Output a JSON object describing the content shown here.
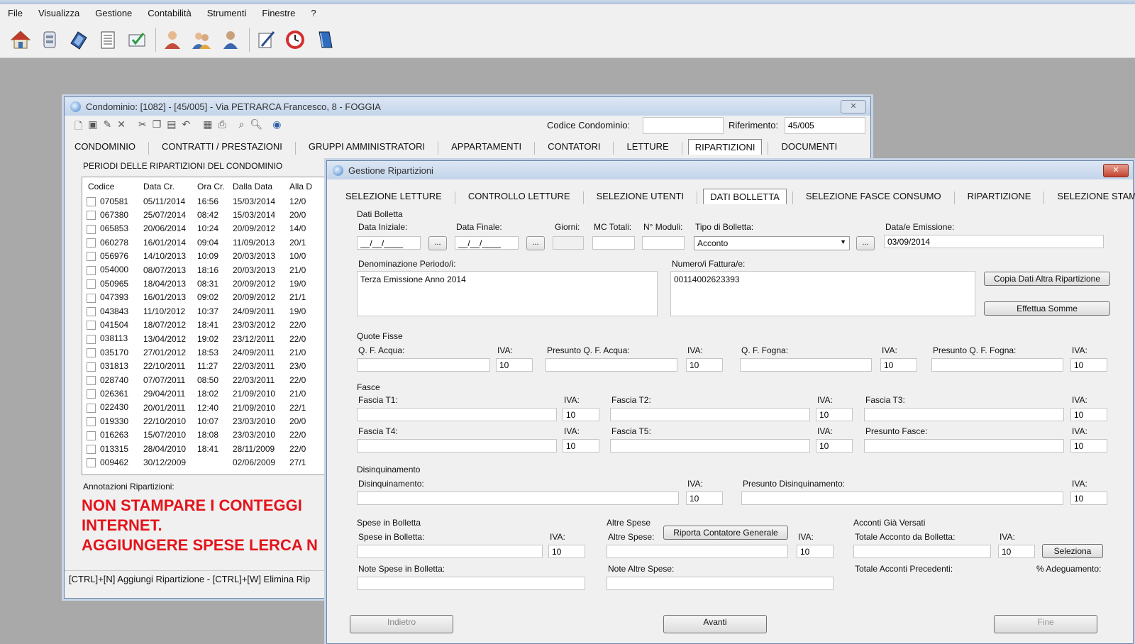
{
  "menu": [
    "File",
    "Visualizza",
    "Gestione",
    "Contabilità",
    "Strumenti",
    "Finestre",
    "?"
  ],
  "toolbar_icons": [
    "home-icon",
    "archive-icon",
    "books-icon",
    "ledger-icon",
    "check-list-icon",
    "user-icon",
    "users-icon",
    "person-icon",
    "edit-icon",
    "clock-icon",
    "book-icon"
  ],
  "cond": {
    "title": "Condominio: [1082] - [45/005] - Via PETRARCA Francesco, 8 - FOGGIA",
    "codice_label": "Codice Condominio:",
    "codice_value": "",
    "riferimento_label": "Riferimento:",
    "riferimento_value": "45/005",
    "tabs": [
      "CONDOMINIO",
      "CONTRATTI / PRESTAZIONI",
      "GRUPPI AMMINISTRATORI",
      "APPARTAMENTI",
      "CONTATORI",
      "LETTURE",
      "RIPARTIZIONI",
      "DOCUMENTI"
    ],
    "section_title": "PERIODI DELLE RIPARTIZIONI DEL CONDOMINIO",
    "columns": [
      "Codice",
      "Data Cr.",
      "Ora Cr.",
      "Dalla Data",
      "Alla D"
    ],
    "rows": [
      [
        "070581",
        "05/11/2014",
        "16:56",
        "15/03/2014",
        "12/0"
      ],
      [
        "067380",
        "25/07/2014",
        "08:42",
        "15/03/2014",
        "20/0"
      ],
      [
        "065853",
        "20/06/2014",
        "10:24",
        "20/09/2012",
        "14/0"
      ],
      [
        "060278",
        "16/01/2014",
        "09:04",
        "11/09/2013",
        "20/1"
      ],
      [
        "056976",
        "14/10/2013",
        "10:09",
        "20/03/2013",
        "10/0"
      ],
      [
        "054000",
        "08/07/2013",
        "18:16",
        "20/03/2013",
        "21/0"
      ],
      [
        "050965",
        "18/04/2013",
        "08:31",
        "20/09/2012",
        "19/0"
      ],
      [
        "047393",
        "16/01/2013",
        "09:02",
        "20/09/2012",
        "21/1"
      ],
      [
        "043843",
        "11/10/2012",
        "10:37",
        "24/09/2011",
        "19/0"
      ],
      [
        "041504",
        "18/07/2012",
        "18:41",
        "23/03/2012",
        "22/0"
      ],
      [
        "038113",
        "13/04/2012",
        "19:02",
        "23/12/2011",
        "22/0"
      ],
      [
        "035170",
        "27/01/2012",
        "18:53",
        "24/09/2011",
        "21/0"
      ],
      [
        "031813",
        "22/10/2011",
        "11:27",
        "22/03/2011",
        "23/0"
      ],
      [
        "028740",
        "07/07/2011",
        "08:50",
        "22/03/2011",
        "22/0"
      ],
      [
        "026361",
        "29/04/2011",
        "18:02",
        "21/09/2010",
        "21/0"
      ],
      [
        "022430",
        "20/01/2011",
        "12:40",
        "21/09/2010",
        "22/1"
      ],
      [
        "019330",
        "22/10/2010",
        "10:07",
        "23/03/2010",
        "20/0"
      ],
      [
        "016263",
        "15/07/2010",
        "18:08",
        "23/03/2010",
        "22/0"
      ],
      [
        "013315",
        "28/04/2010",
        "18:41",
        "28/11/2009",
        "22/0"
      ],
      [
        "009462",
        "30/12/2009",
        "",
        "02/06/2009",
        "27/1"
      ]
    ],
    "annotazioni_label": "Annotazioni Ripartizioni:",
    "annotazioni_lines": [
      "NON STAMPARE I CONTEGGI",
      "INTERNET.",
      "AGGIUNGERE SPESE LERCA N"
    ],
    "status": "[CTRL]+[N] Aggiungi Ripartizione - [CTRL]+[W] Elimina Rip"
  },
  "gest": {
    "title": "Gestione Ripartizioni",
    "tabs": [
      "SELEZIONE LETTURE",
      "CONTROLLO LETTURE",
      "SELEZIONE UTENTI",
      "DATI BOLLETTA",
      "SELEZIONE FASCE CONSUMO",
      "RIPARTIZIONE",
      "SELEZIONE STAMPA"
    ],
    "dati_bolletta": "Dati Bolletta",
    "data_iniziale_label": "Data Iniziale:",
    "data_iniziale": "__/__/____",
    "data_finale_label": "Data Finale:",
    "data_finale": "__/__/____",
    "giorni_label": "Giorni:",
    "mc_totali_label": "MC Totali:",
    "n_moduli_label": "N° Moduli:",
    "tipo_label": "Tipo di Bolletta:",
    "tipo_value": "Acconto",
    "emissione_label": "Data/e Emissione:",
    "emissione_value": "03/09/2014",
    "ellipsis": "...",
    "denominazione_label": "Denominazione Periodo/i:",
    "denominazione_value": "Terza Emissione Anno 2014",
    "fattura_label": "Numero/i Fattura/e:",
    "fattura_value": "00114002623393",
    "copia_btn": "Copia Dati Altra Ripartizione",
    "somme_btn": "Effettua Somme",
    "iva_label": "IVA:",
    "iva_value": "10",
    "quote_fisse": "Quote Fisse",
    "qf_acqua": "Q. F. Acqua:",
    "pres_qf_acqua": "Presunto Q. F. Acqua:",
    "qf_fogna": "Q. F. Fogna:",
    "pres_qf_fogna": "Presunto Q. F. Fogna:",
    "fasce": "Fasce",
    "fascia_t1": "Fascia T1:",
    "fascia_t2": "Fascia T2:",
    "fascia_t3": "Fascia T3:",
    "fascia_t4": "Fascia T4:",
    "fascia_t5": "Fascia T5:",
    "presunto_fasce": "Presunto Fasce:",
    "disinq_group": "Disinquinamento",
    "disinq_label": "Disinquinamento:",
    "pres_disinq": "Presunto Disinquinamento:",
    "spese_group": "Spese in Bolletta",
    "spese_label": "Spese in Bolletta:",
    "note_spese": "Note Spese in Bolletta:",
    "altre_group": "Altre Spese",
    "altre_label": "Altre Spese:",
    "riporta_btn": "Riporta Contatore Generale",
    "note_altre": "Note Altre Spese:",
    "acconti_group": "Acconti Già Versati",
    "tot_acconto": "Totale Acconto da Bolletta:",
    "seleziona_btn": "Seleziona",
    "tot_precedenti": "Totale Acconti Precedenti:",
    "adeguamento": "% Adeguamento:",
    "bottom_btn_1": "Indietro",
    "bottom_btn_2": "Avanti",
    "bottom_btn_3": "Fine"
  }
}
